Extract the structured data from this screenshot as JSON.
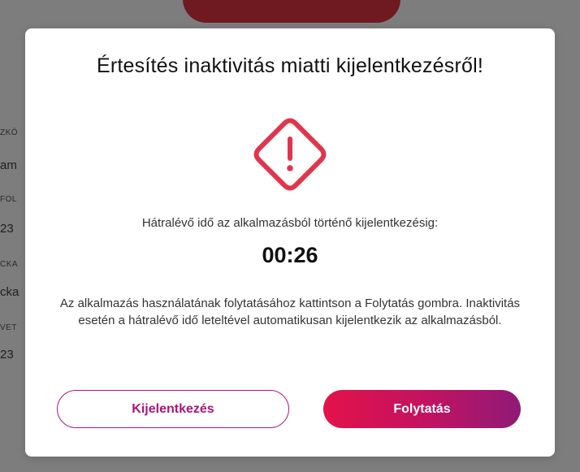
{
  "background": {
    "fragments": [
      {
        "text": "ZKÖ",
        "style": "small"
      },
      {
        "text": "am",
        "style": "normal"
      },
      {
        "text": "FOL",
        "style": "small"
      },
      {
        "text": "23",
        "style": "normal"
      },
      {
        "text": "CKA",
        "style": "small"
      },
      {
        "text": "cka",
        "style": "normal"
      },
      {
        "text": "VET",
        "style": "small"
      },
      {
        "text": "23",
        "style": "normal"
      }
    ]
  },
  "modal": {
    "title": "Értesítés inaktivitás miatti kijelentkezésről!",
    "icon": "warning-diamond-icon",
    "remaining_label": "Hátralévő idő az alkalmazásból történő kijelentkezésig:",
    "timer": "00:26",
    "info_text": "Az alkalmazás használatának folytatásához kattintson a Folytatás gombra. Inaktivitás esetén a hátralévő idő leteltével automatikusan kijelentkezik az alkalmazásból.",
    "logout_label": "Kijelentkezés",
    "continue_label": "Folytatás"
  },
  "colors": {
    "warning": "#e0354d",
    "accent": "#a7177c",
    "gradient_start": "#e3124a",
    "gradient_end": "#8f1a77",
    "overlay": "#7d7d7d"
  }
}
